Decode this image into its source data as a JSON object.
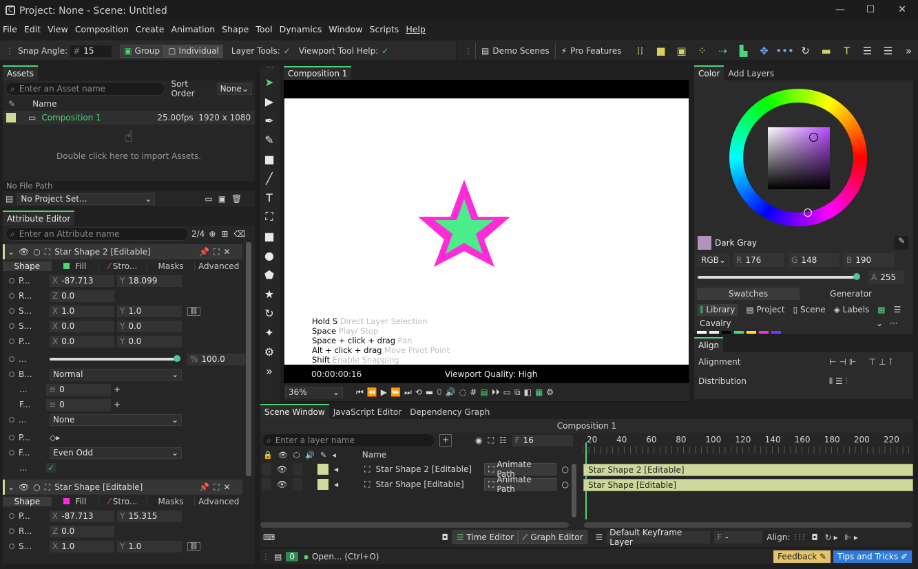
{
  "window": {
    "title": "Project: None - Scene: Untitled",
    "minimize": "—",
    "maximize": "☐",
    "close": "✕"
  },
  "menu": [
    "File",
    "Edit",
    "View",
    "Composition",
    "Create",
    "Animation",
    "Shape",
    "Tool",
    "Dynamics",
    "Window",
    "Scripts",
    "Help"
  ],
  "toolbar": {
    "snap_label": "Snap Angle:",
    "snap_value": "15",
    "group": "Group",
    "individual": "Individual",
    "layer_tools": "Layer Tools:",
    "viewport_help": "Viewport Tool Help:",
    "demo": "Demo Scenes",
    "pro": "Pro Features"
  },
  "assets": {
    "tab": "Assets",
    "search_placeholder": "Enter an Asset name",
    "sort_label": "Sort Order",
    "sort_value": "None",
    "col_name": "Name",
    "item_name": "Composition 1",
    "item_fps": "25.00fps",
    "item_res": "1920 x 1080",
    "import_hint": "Double click here to import Assets.",
    "file_path": "No File Path",
    "project": "No Project Set..."
  },
  "attr": {
    "tab": "Attribute Editor",
    "search_placeholder": "Enter an Attribute name",
    "count": "2/4",
    "layer1": {
      "name": "Star Shape 2 [Editable]",
      "tabs": [
        "Shape",
        "Fill",
        "Stro...",
        "Masks",
        "Advanced"
      ],
      "fill_color": "#4cd47a",
      "rows": [
        {
          "l": "P...",
          "a": "X",
          "av": "-87.713",
          "b": "Y",
          "bv": "18.099"
        },
        {
          "l": "R...",
          "a": "Z",
          "av": "0.0"
        },
        {
          "l": "S...",
          "a": "X",
          "av": "1.0",
          "b": "Y",
          "bv": "1.0"
        },
        {
          "l": "S...",
          "a": "X",
          "av": "0.0",
          "b": "Y",
          "bv": "0.0"
        },
        {
          "l": "P...",
          "a": "X",
          "av": "0.0",
          "b": "Y",
          "bv": "0.0"
        }
      ],
      "opacity_label": "...",
      "opacity": "100.0",
      "opacity_fraction": 1.0,
      "blend_label": "B...",
      "blend": "Normal",
      "r1_label": "...",
      "r1": "0",
      "r2_label": "F...",
      "r2": "0",
      "r3_label": "...",
      "r3": "None",
      "p_label": "P...",
      "f_label": "F...",
      "fill_rule": "Even Odd",
      "chk_label": "..."
    },
    "layer2": {
      "name": "Star Shape [Editable]",
      "tabs": [
        "Shape",
        "Fill",
        "Stro...",
        "Masks",
        "Advanced"
      ],
      "fill_color": "#ff2bd6",
      "rows": [
        {
          "l": "P...",
          "a": "X",
          "av": "-87.713",
          "b": "Y",
          "bv": "15.315"
        },
        {
          "l": "R...",
          "a": "Z",
          "av": "0.0"
        },
        {
          "l": "S...",
          "a": "X",
          "av": "1.0",
          "b": "Y",
          "bv": "1.0"
        }
      ]
    }
  },
  "viewport": {
    "tab": "Composition 1",
    "hints": [
      {
        "k": "Hold S",
        "v": "Direct Layer Selection"
      },
      {
        "k": "Space",
        "v": "Play/ Stop"
      },
      {
        "k": "Space + click + drag",
        "v": "Pan"
      },
      {
        "k": "Alt + click + drag",
        "v": "Move Pivot Point"
      },
      {
        "k": "Shift",
        "v": "Enable Snapping"
      }
    ],
    "time": "00:00:00:16",
    "quality": "Viewport Quality: High",
    "zoom": "36%",
    "frame": "0"
  },
  "color": {
    "tabs": [
      "Color",
      "Add Layers"
    ],
    "name": "Dark Gray",
    "mode": "RGB",
    "r": "176",
    "g": "148",
    "b": "190",
    "a": "255",
    "swatch": "#b094be",
    "alpha_fraction": 1.0,
    "sub_tabs": [
      "Swatches",
      "Generator"
    ],
    "lib_tabs": [
      "Library",
      "Project",
      "Scene",
      "Labels"
    ],
    "palette": "Cavalry"
  },
  "align": {
    "tab": "Align",
    "alignment": "Alignment",
    "distribution": "Distribution"
  },
  "scene": {
    "tabs": [
      "Scene Window",
      "JavaScript Editor",
      "Dependency Graph"
    ],
    "comp": "Composition 1",
    "search_placeholder": "Enter a layer name",
    "frame": "16",
    "col_name": "Name",
    "ticks": [
      "20",
      "40",
      "60",
      "80",
      "100",
      "120",
      "140",
      "160",
      "180",
      "200",
      "220"
    ],
    "layers": [
      {
        "name": "Star Shape 2 [Editable]",
        "action": "Animate Path"
      },
      {
        "name": "Star Shape [Editable]",
        "action": "Animate Path"
      }
    ],
    "time_editor": "Time Editor",
    "graph_editor": "Graph Editor",
    "keyframe_layer": "Default Keyframe Layer",
    "f_value": "-",
    "align": "Align:"
  },
  "status": {
    "count": "0",
    "text": "Open... (Ctrl+O)",
    "feedback": "Feedback",
    "tips": "Tips and Tricks"
  }
}
